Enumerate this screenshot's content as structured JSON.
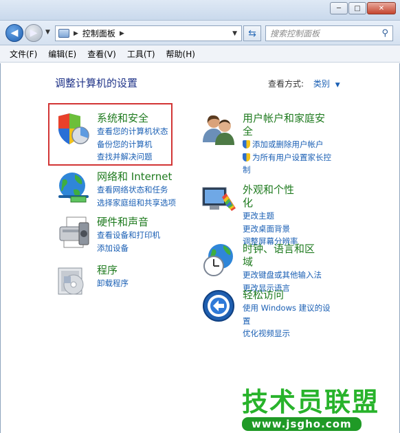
{
  "window": {
    "minimize": "─",
    "maximize": "□",
    "close": "✕"
  },
  "nav": {
    "breadcrumb": "控制面板",
    "search_placeholder": "搜索控制面板"
  },
  "menu": [
    "文件(F)",
    "编辑(E)",
    "查看(V)",
    "工具(T)",
    "帮助(H)"
  ],
  "page": {
    "heading": "调整计算机的设置",
    "view_by_label": "查看方式:",
    "view_by_value": "类别"
  },
  "categories": [
    {
      "title": "系统和安全",
      "icon": "shield-chart-icon",
      "links": [
        "查看您的计算机状态",
        "备份您的计算机",
        "查找并解决问题"
      ]
    },
    {
      "title": "网络和 Internet",
      "icon": "network-globe-icon",
      "links": [
        "查看网络状态和任务",
        "选择家庭组和共享选项"
      ]
    },
    {
      "title": "硬件和声音",
      "icon": "printer-icon",
      "links": [
        "查看设备和打印机",
        "添加设备"
      ]
    },
    {
      "title": "程序",
      "icon": "programs-disc-icon",
      "links": [
        "卸载程序"
      ]
    },
    {
      "title_line1": "用户帐户和家庭安",
      "title_line2": "全",
      "icon": "users-icon",
      "links": [
        "添加或删除用户帐户",
        "为所有用户设置家长控",
        "制"
      ]
    },
    {
      "title": "外观和个性化",
      "icon": "appearance-icon",
      "links": [
        "更改主题",
        "更改桌面背景",
        "调整屏幕分辨率"
      ]
    },
    {
      "title": "时钟、语言和区域",
      "icon": "clock-globe-icon",
      "links": [
        "更改键盘或其他输入法",
        "更改显示语言"
      ]
    },
    {
      "title": "轻松访问",
      "icon": "ease-of-access-icon",
      "links": [
        "使用 Windows 建议的设",
        "置",
        "优化视频显示"
      ]
    }
  ],
  "watermark": {
    "cn": "技术员联盟",
    "url": "www.jsgho.com"
  },
  "colors": {
    "heading": "#1e3287",
    "category_title": "#1e7a1e",
    "link": "#1a5fb4",
    "highlight": "#d23434"
  }
}
